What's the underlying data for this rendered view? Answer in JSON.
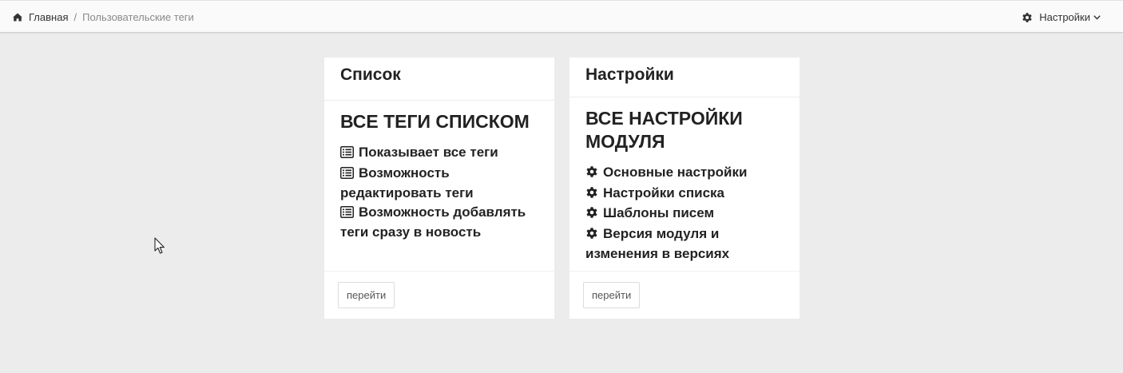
{
  "breadcrumb": {
    "home_label": "Главная",
    "separator": "/",
    "current_label": "Пользовательские теги"
  },
  "topbar": {
    "settings_label": "Настройки"
  },
  "cards": [
    {
      "header": "Список",
      "title": "ВСЕ ТЕГИ СПИСКОМ",
      "icon": "list-icon",
      "features": [
        "Показывает все теги",
        "Возможность редактировать теги",
        "Возможность добавлять теги сразу в новость"
      ],
      "button_label": "перейти"
    },
    {
      "header": "Настройки",
      "title": "ВСЕ НАСТРОЙКИ МОДУЛЯ",
      "icon": "gear-icon",
      "features": [
        "Основные настройки",
        "Настройки списка",
        "Шаблоны писем",
        "Версия модуля и изменения в версиях"
      ],
      "button_label": "перейти"
    }
  ],
  "colors": {
    "page_background": "#ececec",
    "card_background": "#ffffff",
    "text": "#222222",
    "muted_text": "#8a8a8a"
  }
}
